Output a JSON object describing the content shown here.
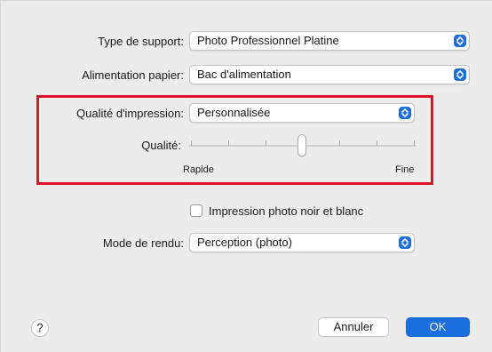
{
  "type_support": {
    "label": "Type de support:",
    "value": "Photo Professionnel Platine"
  },
  "paper_feed": {
    "label": "Alimentation papier:",
    "value": "Bac d'alimentation"
  },
  "print_quality": {
    "label": "Qualité d'impression:",
    "value": "Personnalisée"
  },
  "quality_slider": {
    "label": "Qualité:",
    "min_label": "Rapide",
    "max_label": "Fine",
    "level_fraction": 0.5,
    "ticks": 7
  },
  "bw_photo": {
    "label": "Impression photo noir et blanc",
    "checked": false
  },
  "rendering_mode": {
    "label": "Mode de rendu:",
    "value": "Perception (photo)"
  },
  "help": {
    "label": "?"
  },
  "buttons": {
    "cancel": "Annuler",
    "ok": "OK"
  },
  "colors": {
    "accent": "#1d6fe0",
    "highlight": "#e0122a"
  }
}
